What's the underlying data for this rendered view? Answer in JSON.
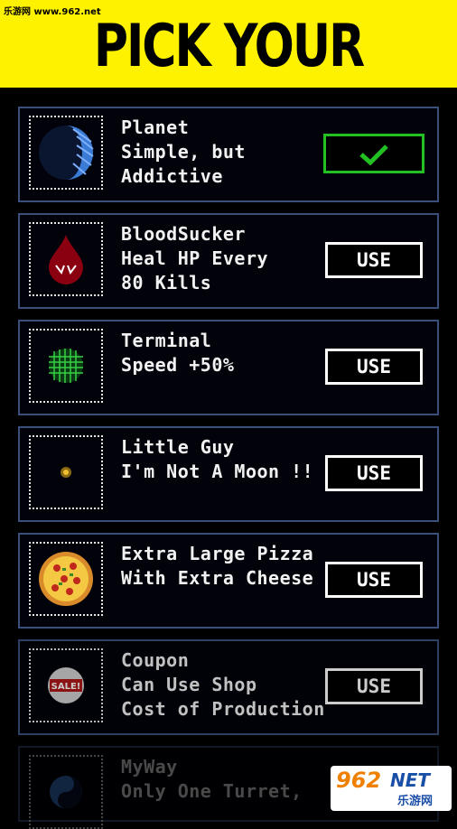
{
  "watermark_top": "乐游网 www.962.net",
  "title": "PICK YOUR PLANET",
  "planets": [
    {
      "name": "Planet",
      "desc": [
        "Simple, but",
        "Addictive"
      ],
      "button": "",
      "selected": true,
      "icon": "blue-planet-icon"
    },
    {
      "name": "BloodSucker",
      "desc": [
        "Heal HP Every",
        "80 Kills"
      ],
      "button": "USE",
      "selected": false,
      "icon": "blood-drop-icon"
    },
    {
      "name": "Terminal",
      "desc": [
        "Speed +50%"
      ],
      "button": "USE",
      "selected": false,
      "icon": "green-grid-planet-icon"
    },
    {
      "name": "Little Guy",
      "desc": [
        "I'm Not A Moon !!"
      ],
      "button": "USE",
      "selected": false,
      "icon": "tiny-planet-icon"
    },
    {
      "name": "Extra Large Pizza",
      "desc": [
        "With Extra Cheese"
      ],
      "button": "USE",
      "selected": false,
      "icon": "pizza-icon"
    },
    {
      "name": "Coupon",
      "desc": [
        "Can Use Shop",
        "Cost of Production"
      ],
      "button": "USE",
      "selected": false,
      "icon": "sale-sign-icon"
    },
    {
      "name": "MyWay",
      "desc": [
        "Only One Turret,"
      ],
      "button": "",
      "selected": false,
      "icon": "yin-yang-icon"
    }
  ],
  "badge": {
    "number": "962",
    "net": "NET",
    "cn": "乐游网"
  },
  "colors": {
    "header": "#fff200",
    "card_border": "#3a4f7a",
    "selected_border": "#22c022"
  }
}
